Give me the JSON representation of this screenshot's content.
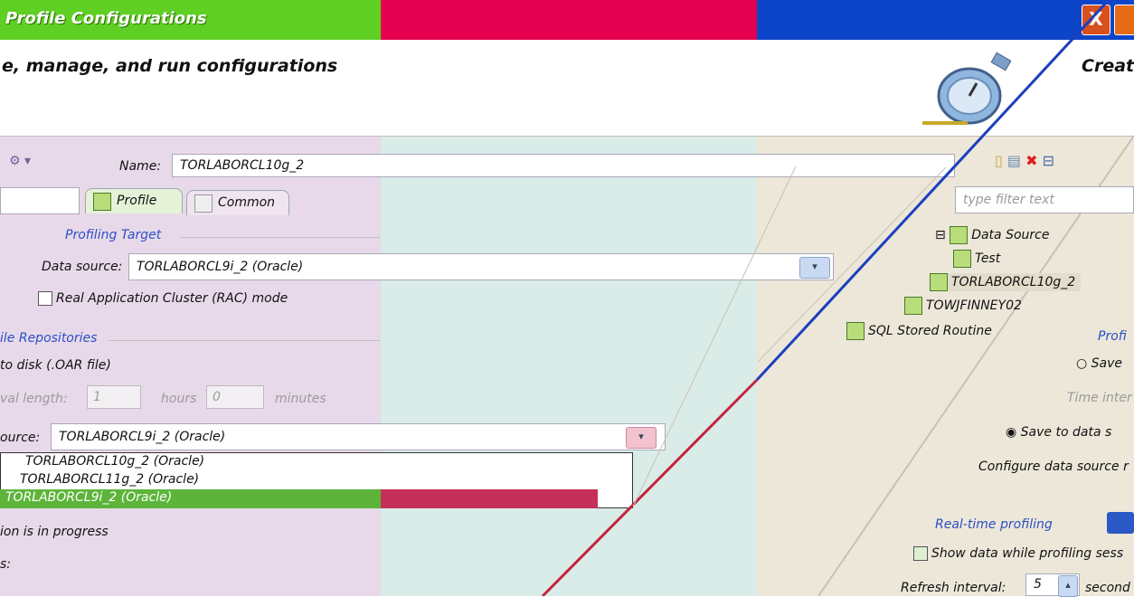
{
  "window": {
    "title": "Profile Configurations",
    "subtitle": "e, manage, and run configurations",
    "right_subtitle": "Creat",
    "close_glyph": "X"
  },
  "config": {
    "name_label": "Name:",
    "name_value": "TORLABORCL10g_2",
    "tabs": [
      {
        "label": "Profile"
      },
      {
        "label": "Common"
      }
    ],
    "profiling_target_group": "Profiling Target",
    "data_source_label": "Data source:",
    "data_source_value": "TORLABORCL9i_2 (Oracle)",
    "rac_label": "Real Application Cluster (RAC) mode",
    "repositories_group": "ile Repositories",
    "save_to_disk_label": "to disk (.OAR file)",
    "interval_label": "val length:",
    "interval_hours_value": "1",
    "hours_label": "hours",
    "interval_minutes_value": "0",
    "minutes_label": "minutes",
    "source_label": "ource:",
    "source_value": "TORLABORCL9i_2 (Oracle)",
    "dropdown_options": [
      "TORLABORCL10g_2 (Oracle)",
      "TORLABORCL11g_2 (Oracle)",
      "TORLABORCL9i_2 (Oracle)"
    ],
    "in_progress_text": "ion is in progress",
    "bottom_left_text": "s:"
  },
  "right": {
    "filter_placeholder": "type filter text",
    "tree": [
      {
        "label": "Data Source",
        "level": 0,
        "expanded": true
      },
      {
        "label": "Test",
        "level": 1
      },
      {
        "label": "TORLABORCL10g_2",
        "level": 1,
        "selected": true
      },
      {
        "label": "TOWJFINNEY02",
        "level": 1
      },
      {
        "label": "SQL Stored Routine",
        "level": 0
      }
    ],
    "profi_label": "Profi",
    "save_radio_label": "Save",
    "time_inter_label": "Time inter",
    "save_to_data_label": "Save to data s",
    "configure_label": "Configure data source r",
    "realtime_group": "Real-time profiling",
    "show_data_label": "Show data while profiling sess",
    "refresh_label": "Refresh interval:",
    "refresh_value": "5",
    "seconds_label": "second"
  },
  "colors": {
    "green": "#5fcf24",
    "red": "#e4004f",
    "blue": "#0d45c8",
    "purple_panel": "#e8d9ea",
    "teal_panel": "#daece8",
    "beige_panel": "#ece7d9"
  }
}
